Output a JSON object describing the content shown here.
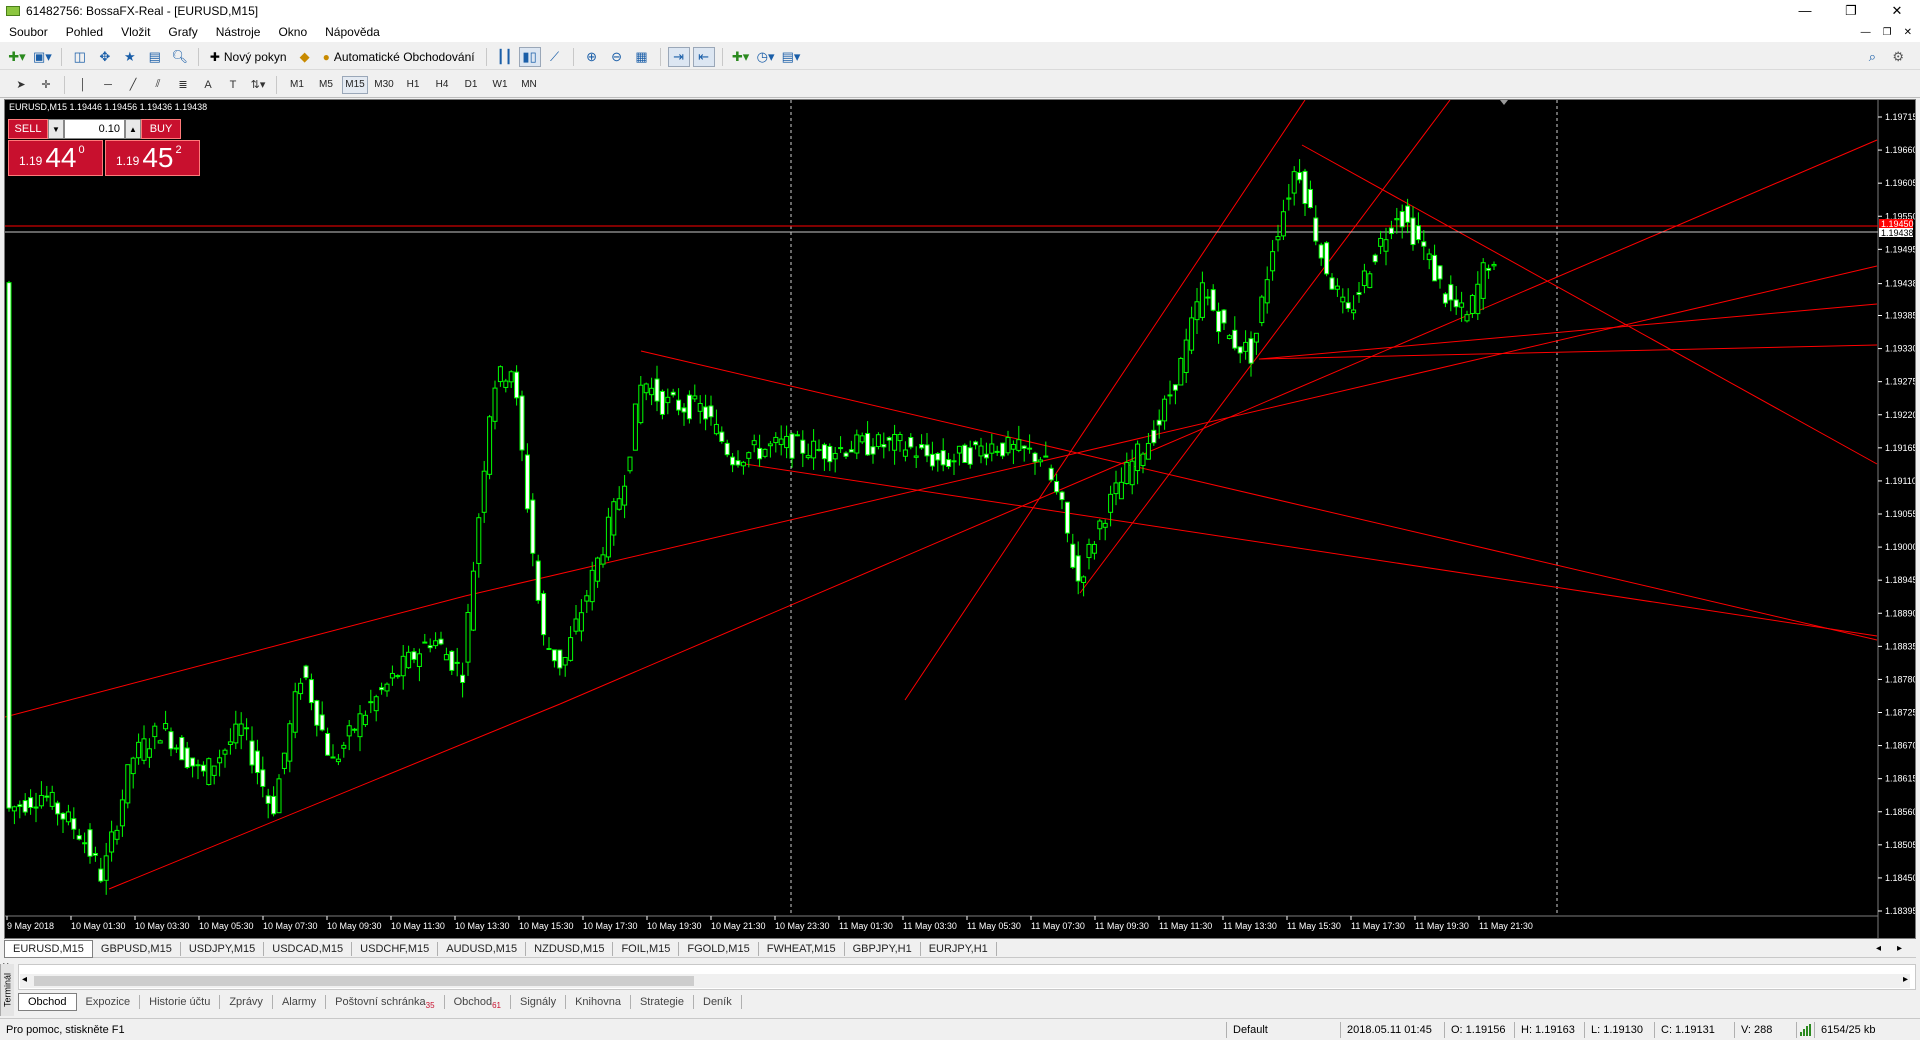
{
  "window": {
    "title": "61482756: BossaFX-Real - [EURUSD,M15]",
    "controls": [
      "—",
      "❐",
      "✕"
    ]
  },
  "menu": {
    "items": [
      "Soubor",
      "Pohled",
      "Vložit",
      "Grafy",
      "Nástroje",
      "Okno",
      "Nápověda"
    ],
    "mdi_controls": [
      "—",
      "❐",
      "✕"
    ]
  },
  "toolbar": {
    "new_order_label": "Nový pokyn",
    "autotrading_label": "Automatické Obchodování"
  },
  "timeframes": [
    "M1",
    "M5",
    "M15",
    "M30",
    "H1",
    "H4",
    "D1",
    "W1",
    "MN"
  ],
  "active_timeframe": "M15",
  "chart": {
    "caption": "EURUSD,M15  1.19446 1.19456 1.19436 1.19438",
    "background": "#000000",
    "bull_color": "#00ff00",
    "bear_color": "#ffffff",
    "line_color": "#ff0000",
    "bid_price_label": "1.19438",
    "ask_price_label": "1.19450",
    "price_axis": [
      "1.19715",
      "1.19660",
      "1.19605",
      "1.19550",
      "1.19495",
      "1.19438",
      "1.19385",
      "1.19330",
      "1.19275",
      "1.19220",
      "1.19165",
      "1.19110",
      "1.19055",
      "1.19000",
      "1.18945",
      "1.18890",
      "1.18835",
      "1.18780",
      "1.18725",
      "1.18670",
      "1.18615",
      "1.18560",
      "1.18505",
      "1.18450",
      "1.18395"
    ],
    "time_axis": [
      "9 May 2018",
      "10 May 01:30",
      "10 May 03:30",
      "10 May 05:30",
      "10 May 07:30",
      "10 May 09:30",
      "10 May 11:30",
      "10 May 13:30",
      "10 May 15:30",
      "10 May 17:30",
      "10 May 19:30",
      "10 May 21:30",
      "10 May 23:30",
      "11 May 01:30",
      "11 May 03:30",
      "11 May 05:30",
      "11 May 07:30",
      "11 May 09:30",
      "11 May 11:30",
      "11 May 13:30",
      "11 May 15:30",
      "11 May 17:30",
      "11 May 19:30",
      "11 May 21:30"
    ]
  },
  "one_click": {
    "sell_label": "SELL",
    "buy_label": "BUY",
    "lot": "0.10",
    "sell_prefix": "1.19",
    "sell_big": "44",
    "sell_sup": "0",
    "buy_prefix": "1.19",
    "buy_big": "45",
    "buy_sup": "2"
  },
  "symbol_tabs": [
    "EURUSD,M15",
    "GBPUSD,M15",
    "USDJPY,M15",
    "USDCAD,M15",
    "USDCHF,M15",
    "AUDUSD,M15",
    "NZDUSD,M15",
    "FOIL,M15",
    "FGOLD,M15",
    "FWHEAT,M15",
    "GBPJPY,H1",
    "EURJPY,H1"
  ],
  "terminal": {
    "side_label": "Terminál",
    "tabs": [
      {
        "label": "Obchod",
        "badge": ""
      },
      {
        "label": "Expozice",
        "badge": ""
      },
      {
        "label": "Historie účtu",
        "badge": ""
      },
      {
        "label": "Zprávy",
        "badge": ""
      },
      {
        "label": "Alarmy",
        "badge": ""
      },
      {
        "label": "Poštovní schránka",
        "badge": "35"
      },
      {
        "label": "Obchod",
        "badge": "61"
      },
      {
        "label": "Signály",
        "badge": ""
      },
      {
        "label": "Knihovna",
        "badge": ""
      },
      {
        "label": "Strategie",
        "badge": ""
      },
      {
        "label": "Deník",
        "badge": ""
      }
    ]
  },
  "status": {
    "help": "Pro pomoc, stiskněte F1",
    "profile": "Default",
    "datetime": "2018.05.11 01:45",
    "open": "O: 1.19156",
    "high": "H: 1.19163",
    "low": "L: 1.19130",
    "close": "C: 1.19131",
    "volume": "V: 288",
    "traffic": "6154/25 kb"
  }
}
